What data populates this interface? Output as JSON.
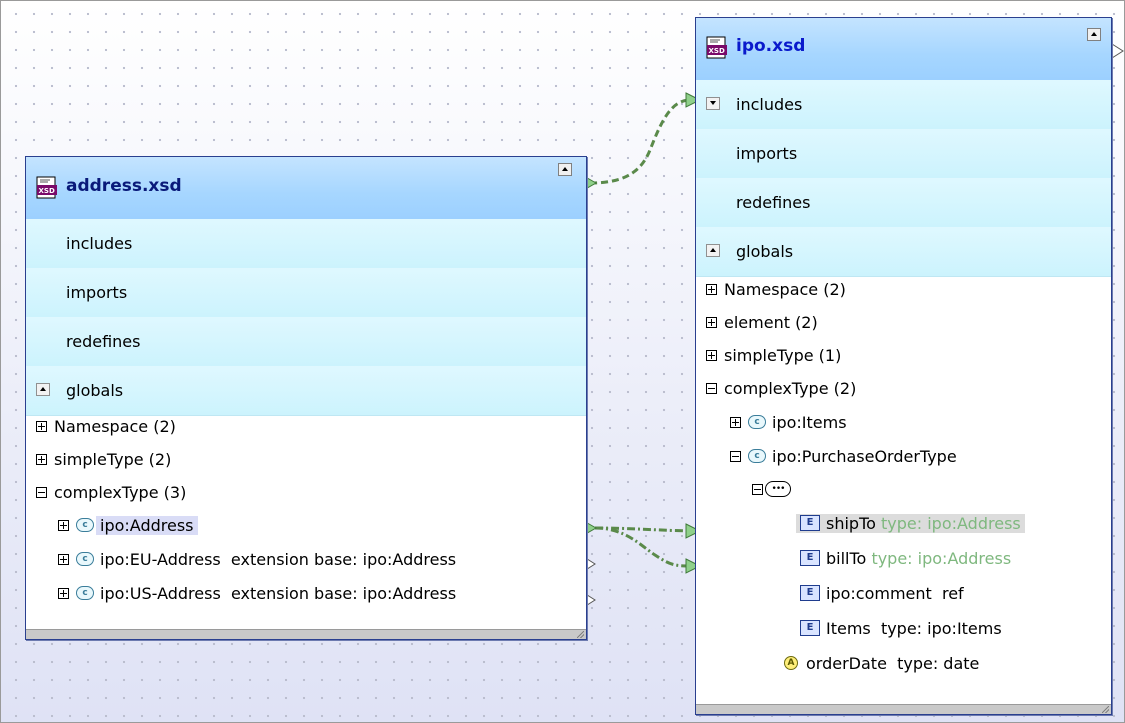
{
  "address_box": {
    "title": "address.xsd",
    "includes_label": "includes",
    "imports_label": "imports",
    "redefines_label": "redefines",
    "globals_label": "globals",
    "tree": [
      {
        "label": "Namespace (2)"
      },
      {
        "label": "simpleType (2)"
      },
      {
        "label": "complexType (3)"
      },
      {
        "label": "ipo:Address"
      },
      {
        "label": "ipo:EU-Address  extension base: ipo:Address"
      },
      {
        "label": "ipo:US-Address  extension base: ipo:Address"
      }
    ]
  },
  "ipo_box": {
    "title": "ipo.xsd",
    "includes_label": "includes",
    "imports_label": "imports",
    "redefines_label": "redefines",
    "globals_label": "globals",
    "tree": [
      {
        "label": "Namespace (2)"
      },
      {
        "label": "element (2)"
      },
      {
        "label": "simpleType (1)"
      },
      {
        "label": "complexType (2)"
      },
      {
        "label": "ipo:Items"
      },
      {
        "label": "ipo:PurchaseOrderType"
      },
      {
        "name": "shipTo",
        "detail": "type: ipo:Address"
      },
      {
        "name": "billTo",
        "detail": "type: ipo:Address"
      },
      {
        "name": "ipo:comment",
        "detail": "ref"
      },
      {
        "name": "Items",
        "detail": "type: ipo:Items"
      },
      {
        "name": "orderDate",
        "detail": "type: date"
      }
    ]
  },
  "icons": {
    "xsd_file": "xsd-file-icon",
    "complex_type": "complex-type-icon",
    "element": "element-icon",
    "attribute": "attribute-icon",
    "sequence": "sequence-icon",
    "expand": "plus-icon",
    "collapse": "minus-icon"
  },
  "colors": {
    "header_gradient": "#a6d6ff",
    "section_rows": "#d4f5fd",
    "box_border": "#2a3f8f",
    "title_text": "#0a1a7a",
    "link_dash": "#5a8a4a",
    "faded_type": "#7fb87f"
  }
}
